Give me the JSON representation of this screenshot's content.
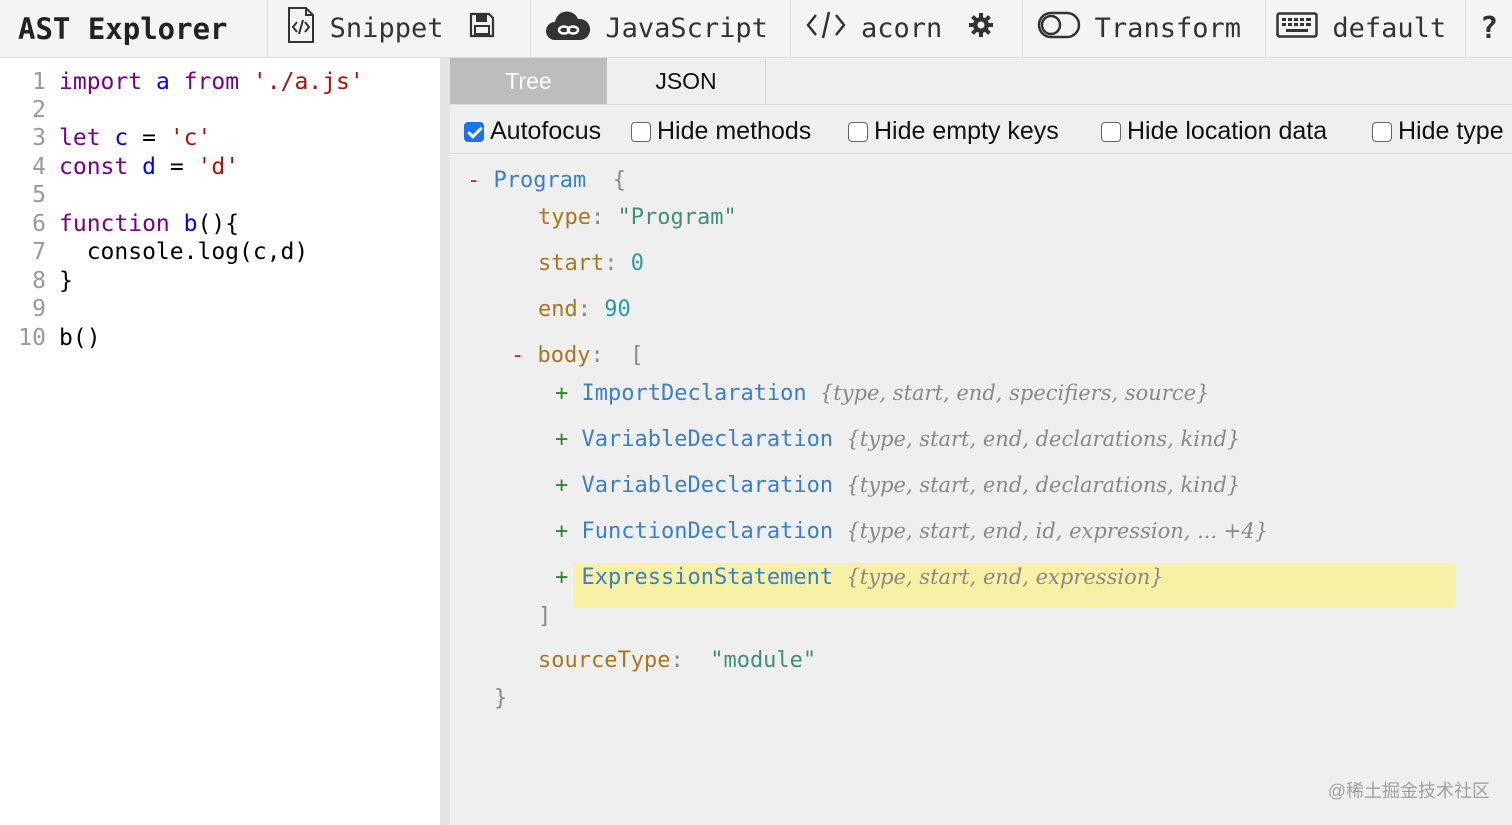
{
  "toolbar": {
    "title": "AST Explorer",
    "snippet_label": "Snippet",
    "language_label": "JavaScript",
    "parser_label": "acorn",
    "transform_label": "Transform",
    "keymap_label": "default",
    "help_label": "?"
  },
  "editor": {
    "lines": [
      {
        "n": "1",
        "parts": [
          [
            "kw",
            "import"
          ],
          [
            "plain",
            " "
          ],
          [
            "var",
            "a"
          ],
          [
            "plain",
            " "
          ],
          [
            "kw",
            "from"
          ],
          [
            "plain",
            " "
          ],
          [
            "str",
            "'./a.js'"
          ]
        ]
      },
      {
        "n": "2",
        "parts": []
      },
      {
        "n": "3",
        "parts": [
          [
            "kw",
            "let"
          ],
          [
            "plain",
            " "
          ],
          [
            "var",
            "c"
          ],
          [
            "plain",
            " = "
          ],
          [
            "str",
            "'c'"
          ]
        ]
      },
      {
        "n": "4",
        "parts": [
          [
            "kw",
            "const"
          ],
          [
            "plain",
            " "
          ],
          [
            "var",
            "d"
          ],
          [
            "plain",
            " = "
          ],
          [
            "str",
            "'d'"
          ]
        ]
      },
      {
        "n": "5",
        "parts": []
      },
      {
        "n": "6",
        "parts": [
          [
            "kw",
            "function"
          ],
          [
            "plain",
            " "
          ],
          [
            "var",
            "b"
          ],
          [
            "plain",
            "(){"
          ]
        ]
      },
      {
        "n": "7",
        "parts": [
          [
            "plain",
            "  console.log(c,d)"
          ]
        ]
      },
      {
        "n": "8",
        "parts": [
          [
            "plain",
            "}"
          ]
        ]
      },
      {
        "n": "9",
        "parts": []
      },
      {
        "n": "10",
        "parts": [
          [
            "plain",
            "b()"
          ]
        ]
      }
    ]
  },
  "tabs": {
    "tree": "Tree",
    "json": "JSON"
  },
  "options": [
    {
      "label": "Autofocus",
      "checked": true
    },
    {
      "label": "Hide methods",
      "checked": false
    },
    {
      "label": "Hide empty keys",
      "checked": false
    },
    {
      "label": "Hide location data",
      "checked": false
    },
    {
      "label": "Hide type",
      "checked": false
    }
  ],
  "tree": {
    "root_name": "Program",
    "type_key": "type",
    "type_value": "\"Program\"",
    "start_key": "start",
    "start_value": "0",
    "end_key": "end",
    "end_value": "90",
    "body_key": "body",
    "children": [
      {
        "name": "ImportDeclaration",
        "summary": "{type, start, end, specifiers, source}"
      },
      {
        "name": "VariableDeclaration",
        "summary": "{type, start, end, declarations, kind}"
      },
      {
        "name": "VariableDeclaration",
        "summary": "{type, start, end, declarations, kind}"
      },
      {
        "name": "FunctionDeclaration",
        "summary": "{type, start, end, id, expression, ... +4}"
      },
      {
        "name": "ExpressionStatement",
        "summary": "{type, start, end, expression}"
      }
    ],
    "sourcetype_key": "sourceType",
    "sourcetype_value": "\"module\""
  },
  "watermark": "@稀土掘金技术社区"
}
